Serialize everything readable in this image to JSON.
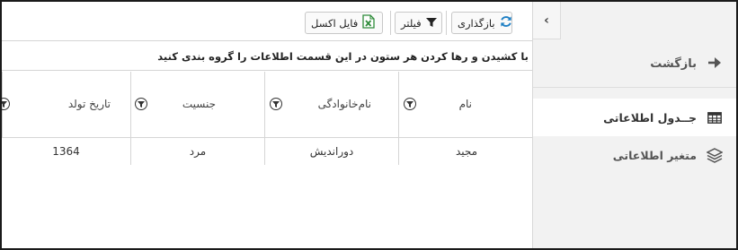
{
  "sidebar": {
    "toggle_glyph": "‹",
    "back_label": "بازگشت",
    "items": [
      {
        "label": "جــدول اطلاعاتی",
        "icon": "table-icon",
        "active": true
      },
      {
        "label": "متغیر اطلاعاتی",
        "icon": "layers-icon",
        "active": false
      }
    ]
  },
  "toolbar": {
    "refresh_label": "بازگذاری",
    "filter_label": "فیلتر",
    "excel_label": "فایل اکسل"
  },
  "group_hint": "با کشیدن و رها کردن هر ستون در این قسمت اطلاعات را گروه بندی کنید",
  "table": {
    "columns": [
      "نام",
      "نام‌خانوادگی",
      "جنسیت",
      "تاریخ تولد"
    ],
    "rows": [
      [
        "مجید",
        "دوراندیش",
        "مرد",
        "1364"
      ]
    ]
  },
  "colors": {
    "accent_blue": "#1e7fc4",
    "excel_green": "#2e8b3a"
  }
}
